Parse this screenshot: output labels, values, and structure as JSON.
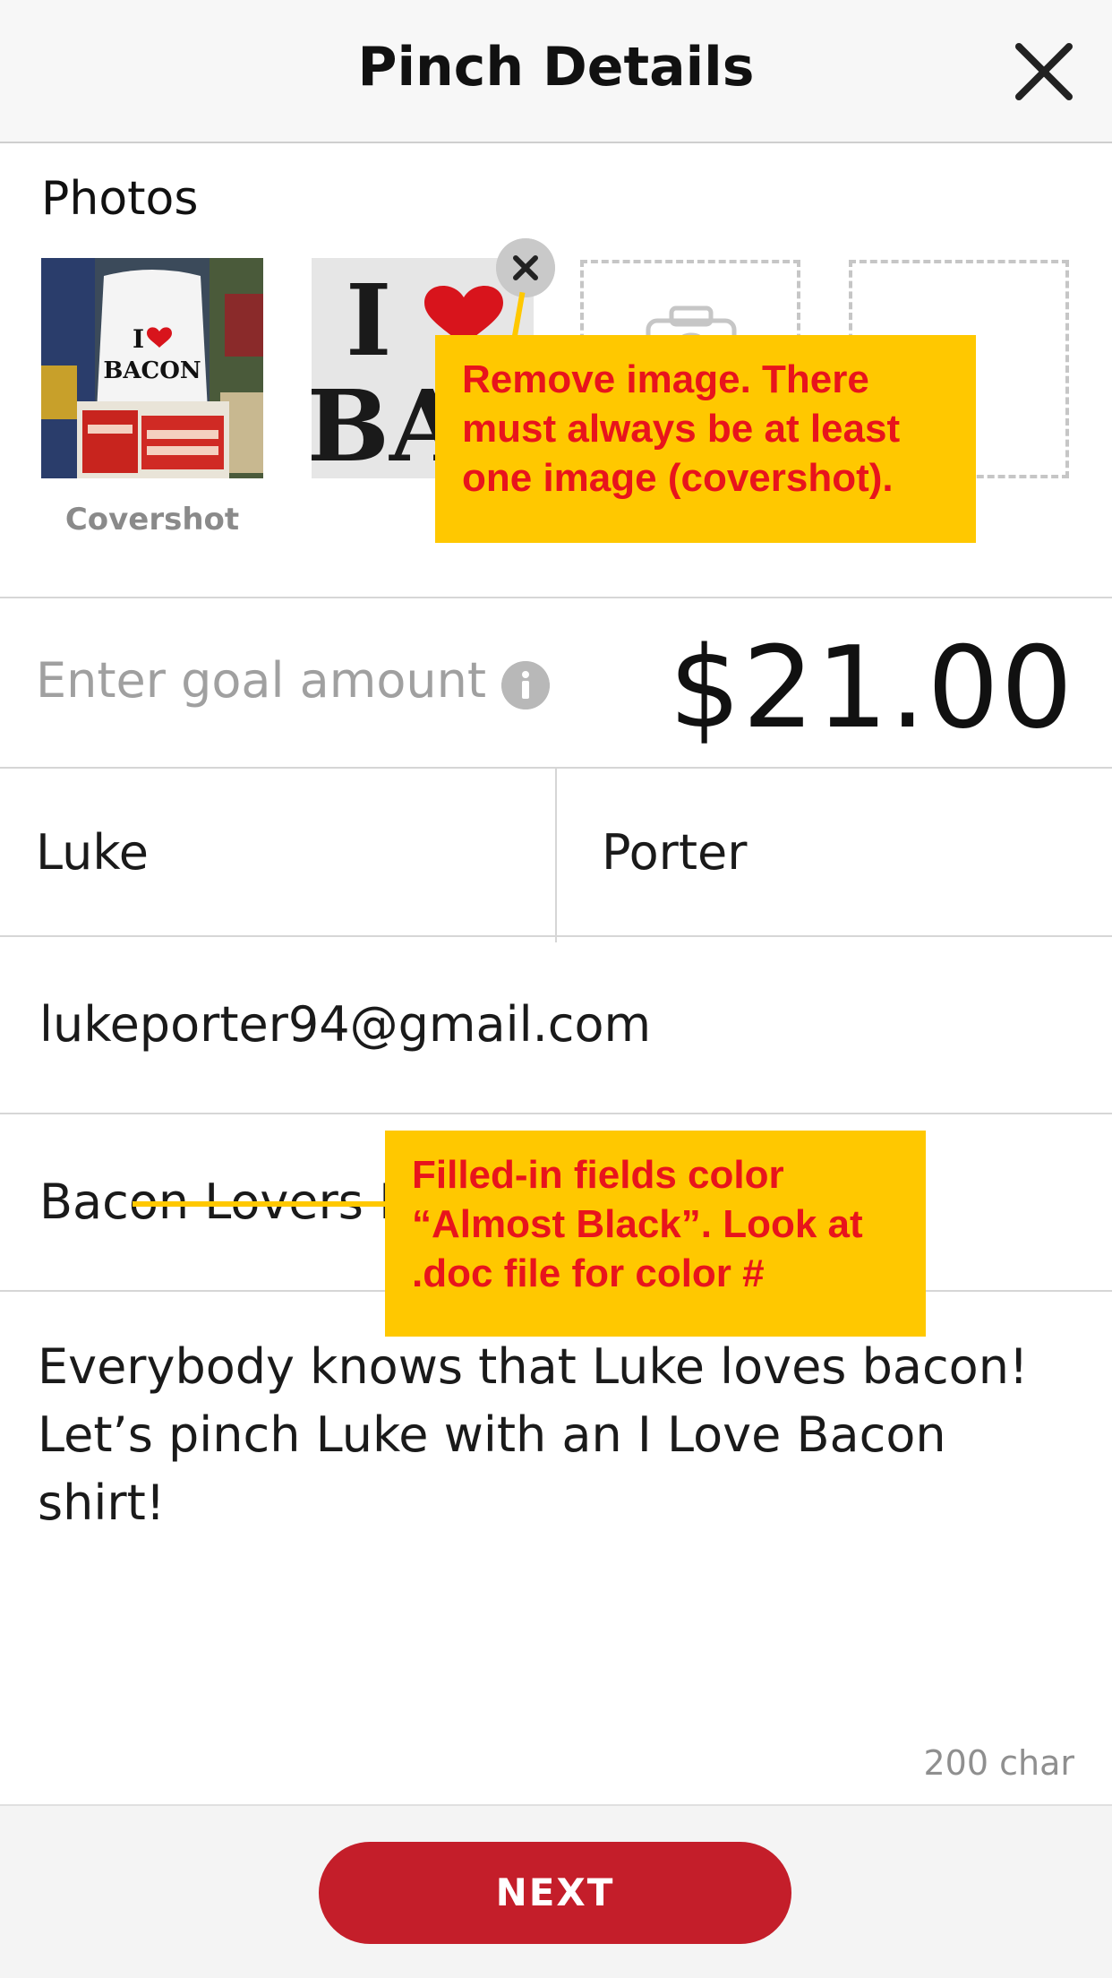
{
  "header": {
    "title": "Pinch Details",
    "close_icon": "close-icon"
  },
  "photos": {
    "section_label": "Photos",
    "covershot_label": "Covershot",
    "remove_icon": "close-circle-icon",
    "empty_slot_icon": "camera-icon",
    "items": [
      {
        "name": "I ♥ BACON shirt on display with bacon packages",
        "shirt_text_1": "I",
        "shirt_text_2": "BACON"
      },
      {
        "name": "I ♥ BACON shirt close-up",
        "shirt_text_1": "I",
        "shirt_text_2": "BAC"
      }
    ]
  },
  "goal": {
    "placeholder": "Enter goal amount",
    "info_icon": "info-icon",
    "amount": "$21.00"
  },
  "form": {
    "first_name": "Luke",
    "last_name": "Porter",
    "email": "lukeporter94@gmail.com",
    "pinch_title": "Bacon Lovers F",
    "description_line1": "Everybody knows that Luke loves bacon!",
    "description_line2": "Let’s pinch Luke with an I Love Bacon shirt!",
    "char_count": "200 char"
  },
  "footer": {
    "next_label": "NEXT"
  },
  "annotations": {
    "remove_image_note": "Remove image. There must always be at least one image (covershot).",
    "filled_fields_note": "Filled-in fields color “Almost Black”. Look at .doc file for color #"
  },
  "colors": {
    "accent_red": "#c41e2a",
    "almost_black": "#1a1a1a",
    "annotation_yellow": "#ffc800",
    "annotation_text": "#e8141c",
    "placeholder_gray": "#a0a0a0"
  }
}
